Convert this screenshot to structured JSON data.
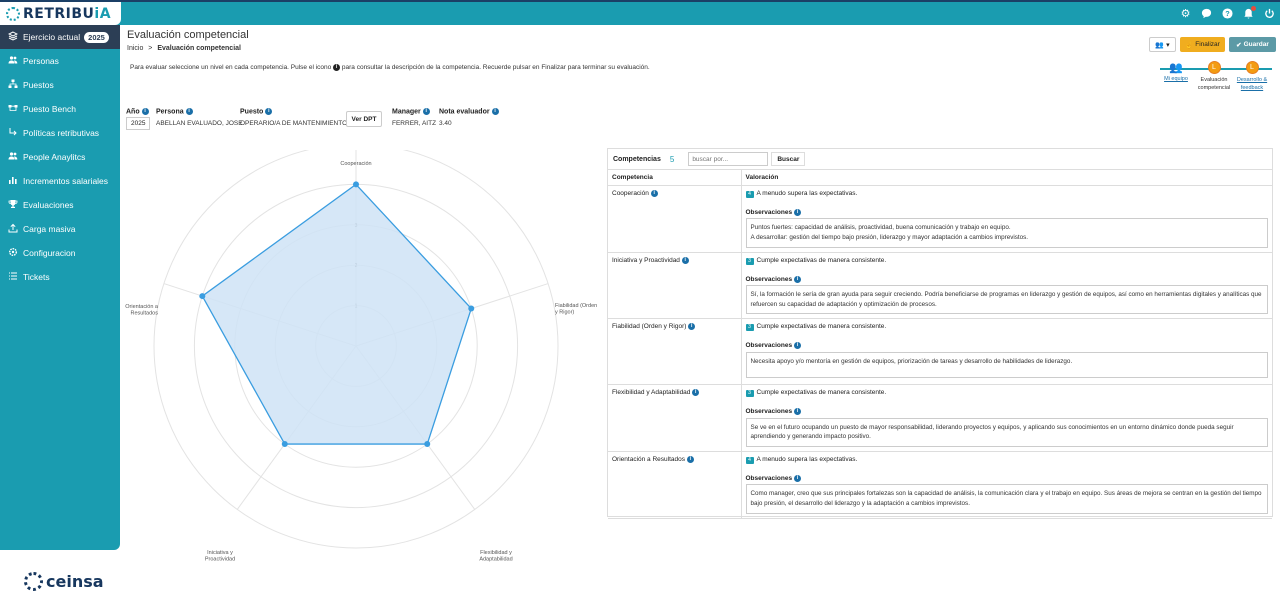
{
  "app": {
    "logo_prefix": "RETRIBU",
    "logo_suffix": "iA"
  },
  "sidebar": {
    "active_item": "Ejercicio actual",
    "active_badge": "2025",
    "items": [
      {
        "label": "Personas",
        "icon": "people-icon"
      },
      {
        "label": "Puestos",
        "icon": "org-icon"
      },
      {
        "label": "Puesto Bench",
        "icon": "bench-icon"
      },
      {
        "label": "Políticas retributivas",
        "icon": "policy-icon"
      },
      {
        "label": "People Anaylitcs",
        "icon": "analytics-icon"
      },
      {
        "label": "Incrementos salariales",
        "icon": "bar-chart-icon"
      },
      {
        "label": "Evaluaciones",
        "icon": "trophy-icon"
      },
      {
        "label": "Carga masiva",
        "icon": "upload-icon"
      },
      {
        "label": "Configuracion",
        "icon": "gear-icon"
      },
      {
        "label": "Tickets",
        "icon": "list-icon"
      }
    ],
    "footer_brand": "ceinsa"
  },
  "header": {
    "title": "Evaluación competencial",
    "breadcrumb_home": "Inicio",
    "breadcrumb_sep": ">",
    "breadcrumb_current": "Evaluación competencial",
    "instructions_before": "Para evaluar seleccione un nivel en cada competencia. Pulse el icono",
    "instructions_after": "para consultar la descripción de la competencia. Recuerde pulsar en Finalizar para terminar su evaluación.",
    "btn_finalizar": "Finalizar",
    "btn_guardar": "Guardar"
  },
  "steps": [
    {
      "label": "Mi equipo",
      "link": true
    },
    {
      "label": "Evaluación competencial",
      "link": false
    },
    {
      "label": "Desarrollo & feedback",
      "link": true
    }
  ],
  "info": {
    "year_label": "Año",
    "year_value": "2025",
    "person_label": "Persona",
    "person_value": "ABELLAN EVALUADO, JOSE",
    "job_label": "Puesto",
    "job_value": "OPERARIO/A DE MANTENIMIENTO",
    "btn_ver_dpt": "Ver DPT",
    "manager_label": "Manager",
    "manager_value": "FERRER, AITZ",
    "score_label": "Nota evaluador",
    "score_value": "3.40"
  },
  "chart_data": {
    "type": "radar",
    "categories": [
      "Cooperación",
      "Fiabilidad (Orden y Rigor)",
      "Flexibilidad y Adaptabilidad",
      "Iniciativa y Proactividad",
      "Orientación a Resultados"
    ],
    "values": [
      4,
      3,
      3,
      3,
      4
    ],
    "rmax": 5,
    "ticks": [
      1,
      2,
      3,
      4,
      5
    ],
    "fill_color": "#cfe3f6",
    "line_color": "#3a9de0"
  },
  "competencias": {
    "label": "Competencias",
    "count": "5",
    "search_placeholder": "buscar por...",
    "btn_buscar": "Buscar",
    "col_competencia": "Competencia",
    "col_valoracion": "Valoración",
    "obs_label": "Observaciones",
    "rows": [
      {
        "name": "Cooperación",
        "level": "4",
        "valoracion": "A menudo supera las expectativas.",
        "obs": "Puntos fuertes: capacidad de análisis, proactividad, buena comunicación y trabajo en equipo.\nA desarrollar: gestión del tiempo bajo presión, liderazgo y mayor adaptación a cambios imprevistos."
      },
      {
        "name": "Iniciativa y Proactividad",
        "level": "3",
        "valoracion": "Cumple expectativas de manera consistente.",
        "obs": "Sí, la formación le sería de gran ayuda para seguir creciendo. Podría beneficiarse de programas en liderazgo y gestión de equipos, así como en herramientas digitales y analíticas que refuercen su capacidad de adaptación y optimización de procesos."
      },
      {
        "name": "Fiabilidad (Orden y Rigor)",
        "level": "3",
        "valoracion": "Cumple expectativas de manera consistente.",
        "obs": "Necesita apoyo y/o mentoría en gestión de equipos, priorización de tareas y desarrollo de habilidades de liderazgo."
      },
      {
        "name": "Flexibilidad y Adaptabilidad",
        "level": "3",
        "valoracion": "Cumple expectativas de manera consistente.",
        "obs": "Se ve en el futuro ocupando un puesto de mayor responsabilidad, liderando proyectos y equipos, y aplicando sus conocimientos en un entorno dinámico donde pueda seguir aprendiendo y generando impacto positivo."
      },
      {
        "name": "Orientación a Resultados",
        "level": "4",
        "valoracion": "A menudo supera las expectativas.",
        "obs": "Como manager, creo que sus principales fortalezas son la capacidad de análisis, la comunicación clara y el trabajo en equipo. Sus áreas de mejora se centran en la gestión del tiempo bajo presión, el desarrollo del liderazgo y la adaptación a cambios imprevistos."
      }
    ]
  }
}
